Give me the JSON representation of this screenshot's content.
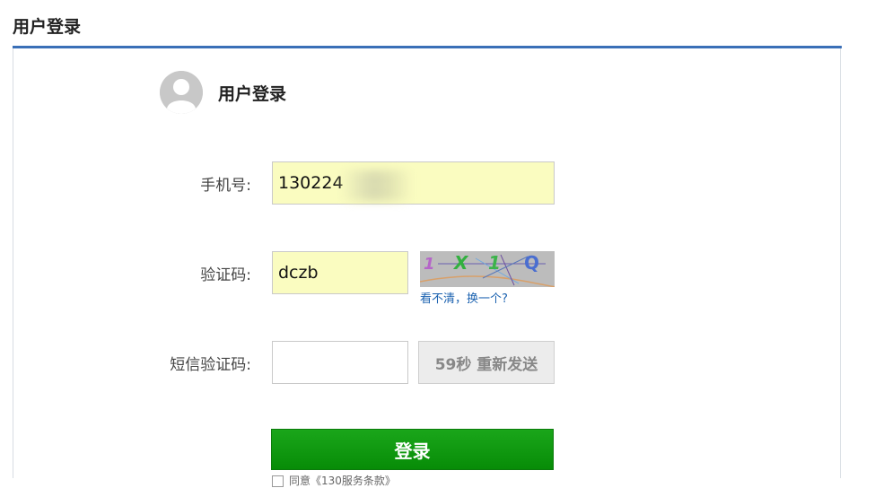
{
  "page": {
    "title": "用户登录"
  },
  "panel": {
    "heading": "用户登录",
    "avatar_icon": "user-avatar-icon"
  },
  "form": {
    "phone_label": "手机号:",
    "phone_value": "130224",
    "captcha_label": "验证码:",
    "captcha_value": "dczb",
    "captcha_text": "1X1Q",
    "captcha_refresh_link": "看不清，换一个?",
    "sms_label": "短信验证码:",
    "sms_value": "",
    "sms_button": "59秒 重新发送",
    "login_button": "登录",
    "agreement": "同意《130服务条款》"
  },
  "colors": {
    "accent_rule": "#3a6fb7",
    "login_green": "#0b8f0b",
    "input_fill": "#fafcc0",
    "link_blue": "#1b62b0"
  }
}
